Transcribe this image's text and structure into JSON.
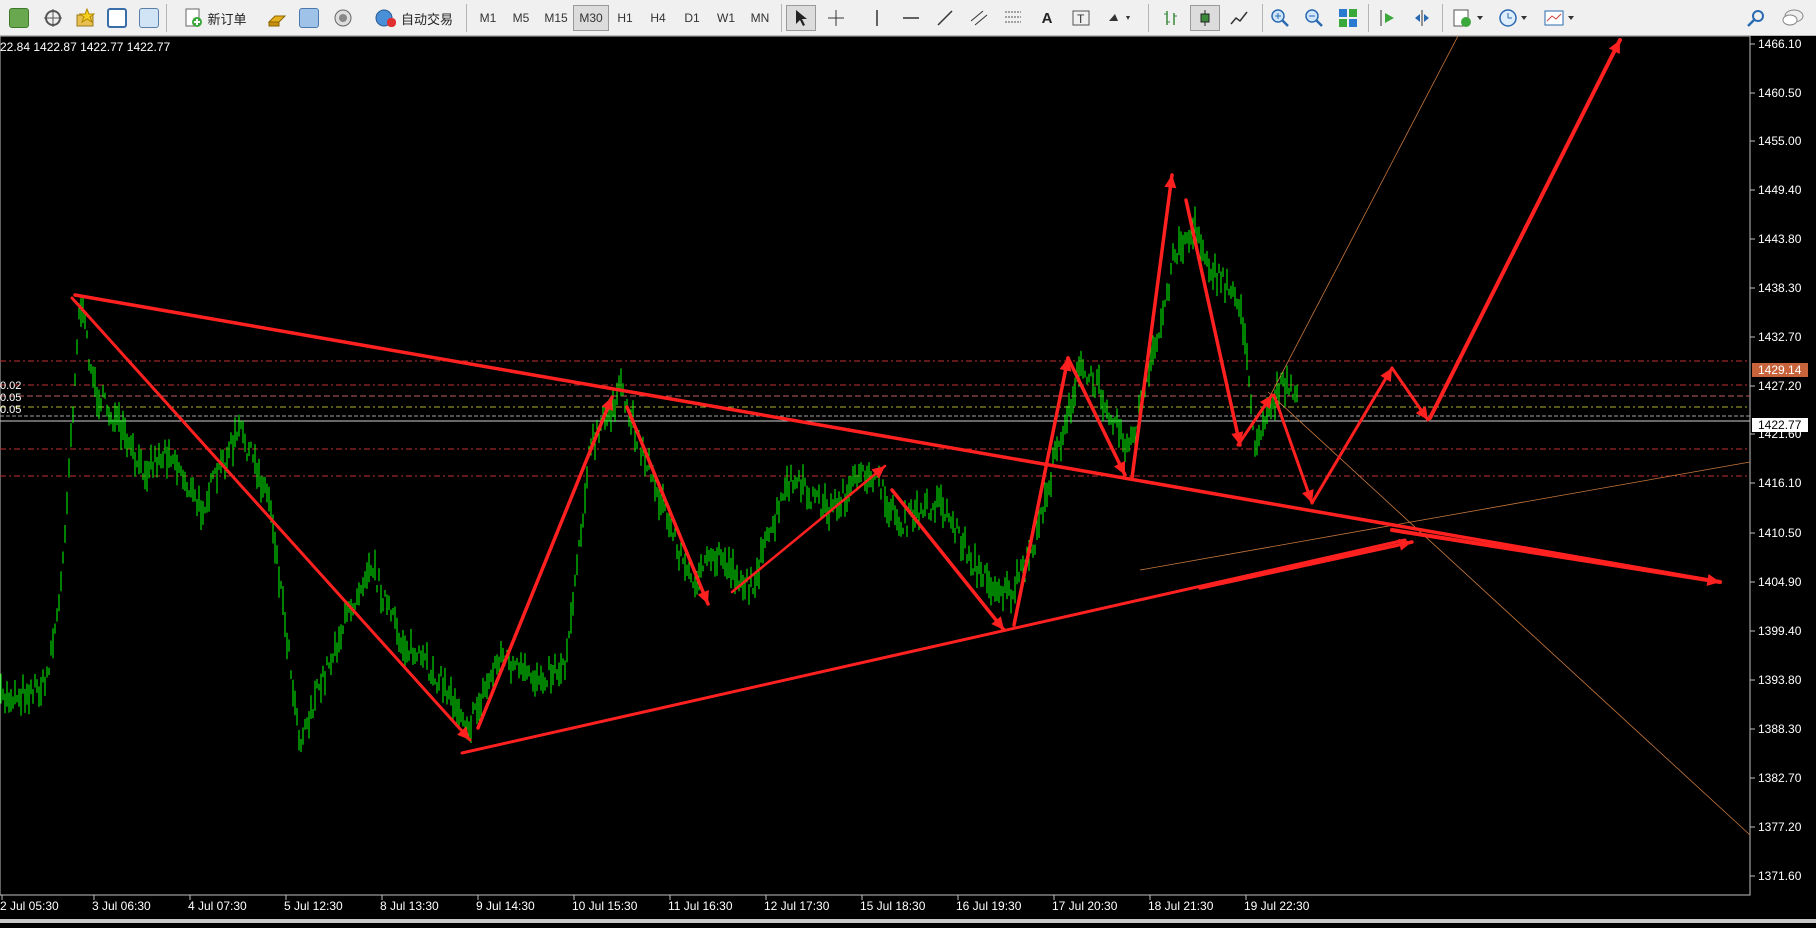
{
  "toolbar": {
    "new_order": "新订单",
    "auto_trading": "自动交易",
    "timeframes": [
      "M1",
      "M5",
      "M15",
      "M30",
      "H1",
      "H4",
      "D1",
      "W1",
      "MN"
    ],
    "active_timeframe": "M30"
  },
  "chart": {
    "info": "22.84 1422.87 1422.77 1422.77",
    "price_labels": [
      "1466.10",
      "1460.50",
      "1455.00",
      "1449.40",
      "1443.80",
      "1438.30",
      "1432.70",
      "1427.20",
      "1421.60",
      "1416.10",
      "1410.50",
      "1404.90",
      "1399.40",
      "1393.80",
      "1388.30",
      "1382.70",
      "1377.20",
      "1371.60"
    ],
    "time_labels": [
      "2 Jul 05:30",
      "3 Jul 06:30",
      "4 Jul 07:30",
      "5 Jul 12:30",
      "8 Jul 13:30",
      "9 Jul 14:30",
      "10 Jul 15:30",
      "11 Jul 16:30",
      "12 Jul 17:30",
      "15 Jul 18:30",
      "16 Jul 19:30",
      "17 Jul 20:30",
      "18 Jul 21:30",
      "19 Jul 22:30"
    ],
    "level_labels": [
      "0.02",
      "0.05",
      "0.05"
    ],
    "current_price": "1422.77",
    "level_price": "1429.14",
    "colors": {
      "background": "#000000",
      "bars": "#00ff00",
      "drawing": "#ff2020",
      "grid_text": "#ffffff",
      "level_tag": "#c8643c"
    }
  }
}
